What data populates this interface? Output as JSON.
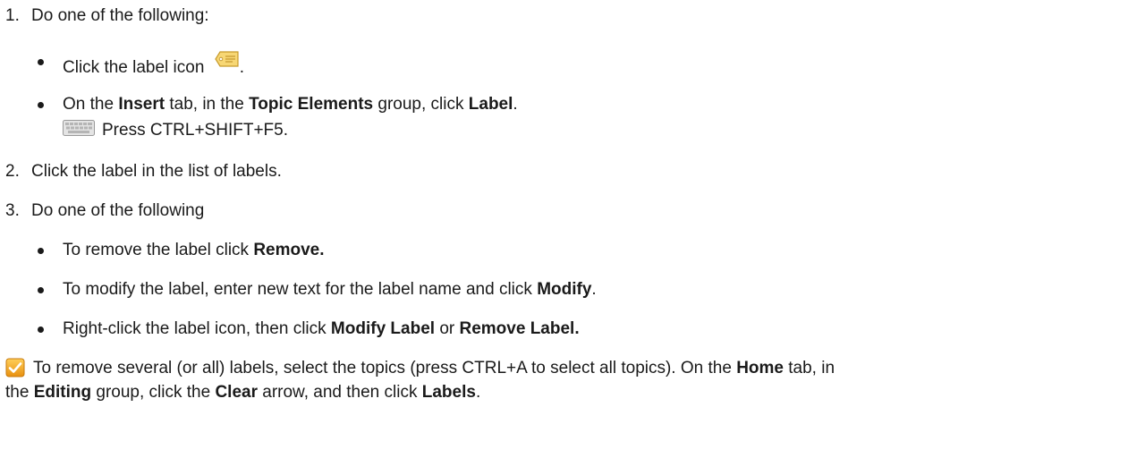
{
  "steps": {
    "s1": {
      "number": "1.",
      "text": "Do one of the following:",
      "bullets": {
        "b1": {
          "text": "Click the label icon",
          "after_icon": "."
        },
        "b2": {
          "t1": "On the ",
          "k1": "Insert",
          "t2": " tab, in the ",
          "k2": "Topic Elements",
          "t3": " group, click ",
          "k3": "Label",
          "t4": "."
        }
      },
      "shortcut": {
        "icon": "keyboard-icon",
        "text": "Press CTRL+SHIFT+F5."
      }
    },
    "s2": {
      "number": "2.",
      "text": "Click the label in the list of labels."
    },
    "s3": {
      "number": "3.",
      "text": "Do one of the following",
      "bullets": {
        "b1": {
          "t1": "To remove the label click ",
          "k1": "Remove."
        },
        "b2": {
          "t1": "To modify the label, enter new text for the label name and click ",
          "k1": "Modify",
          "t2": "."
        },
        "b3": {
          "t1": "Right-click the label icon, then click ",
          "k1": "Modify Label",
          "t2": " or ",
          "k2": "Remove Label."
        }
      }
    }
  },
  "tip": {
    "icon": "checkbox-tip-icon",
    "line1": {
      "t1": "To remove several (or all) labels, select the topics (press CTRL+A to select all topics). On the ",
      "k1": "Home",
      "t2": " tab, in"
    },
    "line2": {
      "t1": "the ",
      "k1": "Editing",
      "t2": " group, click the ",
      "k2": "Clear",
      "t3": " arrow, and then click ",
      "k3": "Labels",
      "t4": "."
    }
  },
  "colors": {
    "text": "#1a1a1a",
    "label_icon_fill": "#f7d774",
    "checkbox_fill": "#f2a51a"
  }
}
